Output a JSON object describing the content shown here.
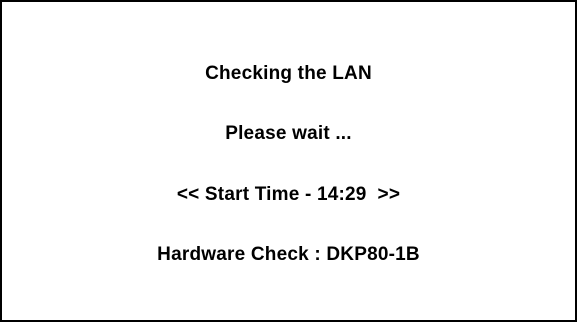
{
  "dialog": {
    "status_line": "Checking the LAN",
    "wait_line": "Please wait ...",
    "start_time_line": "<< Start Time - 14:29  >>",
    "hardware_check_line": "Hardware Check : DKP80-1B"
  },
  "colors": {
    "background": "#ffffff",
    "border": "#000000",
    "text": "#000000"
  }
}
